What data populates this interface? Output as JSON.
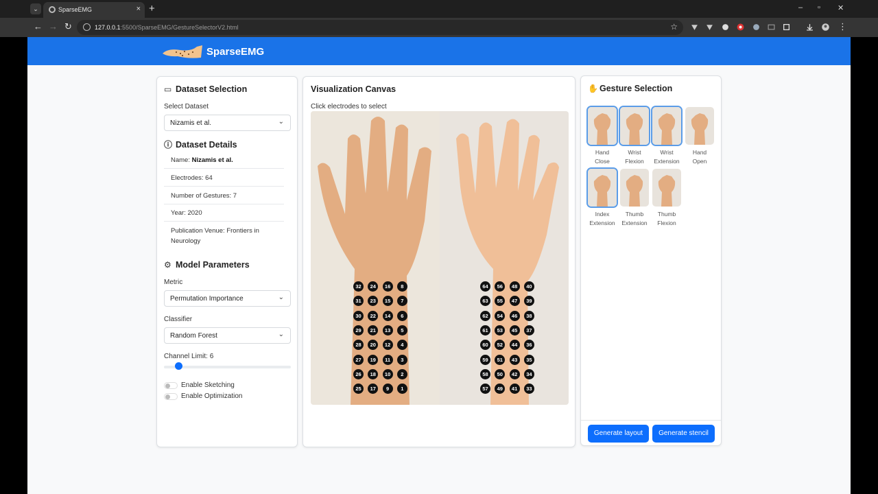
{
  "browser": {
    "tab_title": "SparseEMG",
    "tab_close": "×",
    "new_tab": "+",
    "url_host": "127.0.0.1",
    "url_rest": ":5500/SparseEMG/GestureSelectorV2.html"
  },
  "app": {
    "brand": "SparseEMG"
  },
  "dataset": {
    "title": "Dataset Selection",
    "select_label": "Select Dataset",
    "selected": "Nizamis et al."
  },
  "details": {
    "title": "Dataset Details",
    "name_label": "Name:",
    "name_value": "Nizamis et al.",
    "electrodes": "Electrodes: 64",
    "gestures": "Number of Gestures: 7",
    "year": "Year: 2020",
    "venue": "Publication Venue: Frontiers in Neurology"
  },
  "model": {
    "title": "Model Parameters",
    "metric_label": "Metric",
    "metric_value": "Permutation Importance",
    "classifier_label": "Classifier",
    "classifier_value": "Random Forest",
    "channel_limit": "Channel Limit: 6",
    "slider_fraction": 0.1,
    "sketching": "Enable Sketching",
    "optimization": "Enable Optimization"
  },
  "canvas": {
    "title": "Visualization Canvas",
    "hint": "Click electrodes to select",
    "back_electrodes": [
      [
        32,
        24,
        16,
        8
      ],
      [
        31,
        23,
        15,
        7
      ],
      [
        30,
        22,
        14,
        6
      ],
      [
        29,
        21,
        13,
        5
      ],
      [
        28,
        20,
        12,
        4
      ],
      [
        27,
        19,
        11,
        3
      ],
      [
        26,
        18,
        10,
        2
      ],
      [
        25,
        17,
        9,
        1
      ]
    ],
    "palm_electrodes": [
      [
        64,
        56,
        48,
        40
      ],
      [
        63,
        55,
        47,
        39
      ],
      [
        62,
        54,
        46,
        38
      ],
      [
        61,
        53,
        45,
        37
      ],
      [
        60,
        52,
        44,
        36
      ],
      [
        59,
        51,
        43,
        35
      ],
      [
        58,
        50,
        42,
        34
      ],
      [
        57,
        49,
        41,
        33
      ]
    ]
  },
  "gestures": {
    "title": "Gesture Selection",
    "items": [
      {
        "line1": "Hand",
        "line2": "Close",
        "selected": true
      },
      {
        "line1": "Wrist",
        "line2": "Flexion",
        "selected": true
      },
      {
        "line1": "Wrist",
        "line2": "Extension",
        "selected": true
      },
      {
        "line1": "Hand",
        "line2": "Open",
        "selected": false
      },
      {
        "line1": "Index",
        "line2": "Extension",
        "selected": true
      },
      {
        "line1": "Thumb",
        "line2": "Extension",
        "selected": false
      },
      {
        "line1": "Thumb",
        "line2": "Flexion",
        "selected": false
      }
    ],
    "generate_layout": "Generate layout",
    "generate_stencil": "Generate stencil"
  },
  "colors": {
    "appbar": "#1a73e8",
    "button": "#0d6efd",
    "skin": "#e8b48a",
    "backdrop": "#ece6dc"
  }
}
